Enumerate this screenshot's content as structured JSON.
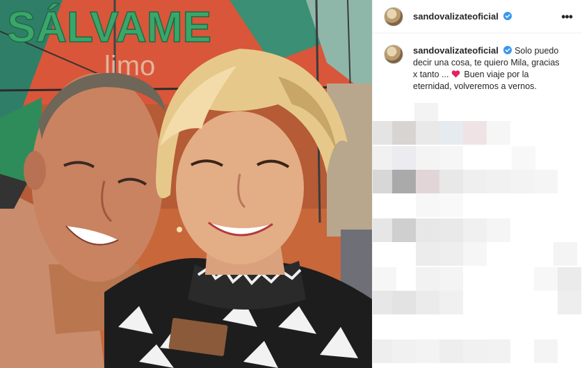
{
  "post": {
    "username": "sandovalizateoficial",
    "more_icon": "more-horizontal-icon",
    "verified_icon": "verified-badge-icon",
    "caption": {
      "username": "sandovalizateoficial",
      "text_before_heart": "Solo puedo decir una cosa, te quiero Mila, gracias x tanto ...",
      "heart_icon": "red-heart-emoji",
      "text_after_heart": "Buen viaje por la eternidad, volveremos a vernos."
    },
    "photo": {
      "sign_text": "SÁLVAME",
      "sign_subtext": "limo",
      "badge_text": ""
    }
  },
  "colors": {
    "verified": "#3897f0",
    "heart": "#e0245e",
    "sign_green": "#3aa66a",
    "sign_background": "#e35a34"
  }
}
